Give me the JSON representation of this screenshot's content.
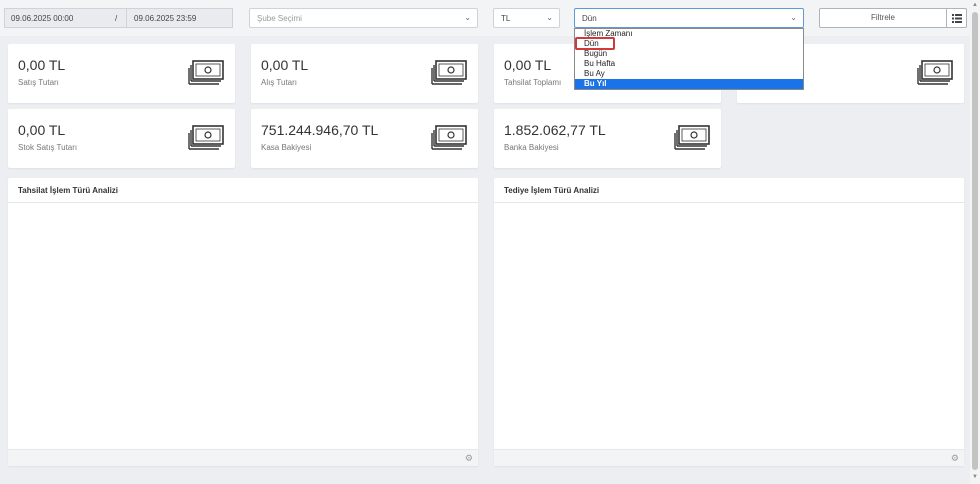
{
  "filters": {
    "date_start": "09.06.2025 00:00",
    "date_separator": "/",
    "date_end": "09.06.2025 23:59",
    "sube_placeholder": "Şube Seçimi",
    "currency": "TL",
    "date_range": "Dün",
    "filter_button": "Filtrele"
  },
  "dropdown": {
    "options": [
      "İşlem Zamanı",
      "Dün",
      "Bugün",
      "Bu Hafta",
      "Bu Ay",
      "Bu Yıl"
    ],
    "highlighted": "Bu Yıl",
    "selected": "Dün"
  },
  "cards": {
    "satis": {
      "value": "0,00 TL",
      "label": "Satış Tutarı"
    },
    "alis": {
      "value": "0,00 TL",
      "label": "Alış Tutarı"
    },
    "tahsilat": {
      "value": "0,00 TL",
      "label": "Tahsilat Toplamı"
    },
    "stok": {
      "value": "0,00 TL",
      "label": "Stok Satış Tutarı"
    },
    "kasa": {
      "value": "751.244.946,70 TL",
      "label": "Kasa Bakiyesi"
    },
    "banka": {
      "value": "1.852.062,77 TL",
      "label": "Banka Bakiyesi"
    }
  },
  "panels": {
    "tahsilat_title": "Tahsilat İşlem Türü Analizi",
    "tediye_title": "Tediye İşlem Türü Analizi"
  },
  "icons": {
    "money": "money-stack-icon",
    "list": "list-icon",
    "gear": "gear-icon",
    "chevron": "chevron-down-icon"
  },
  "colors": {
    "selected_option": "#1a73e8",
    "highlight_box": "#d23a3a",
    "focus_border": "#5a9bd8"
  }
}
